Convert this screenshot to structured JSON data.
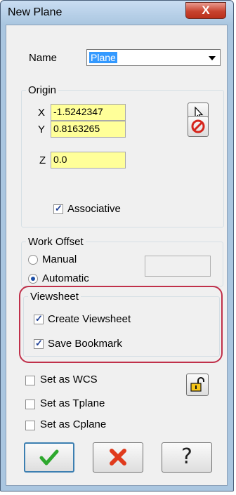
{
  "window": {
    "title": "New Plane",
    "close_label": "X"
  },
  "name": {
    "label": "Name",
    "value": "Plane"
  },
  "origin": {
    "title": "Origin",
    "x_label": "X",
    "x_value": "-1.5242347",
    "y_label": "Y",
    "y_value": "0.8163265",
    "z_label": "Z",
    "z_value": "0.0",
    "associative_label": "Associative",
    "associative_checked": true
  },
  "work_offset": {
    "title": "Work Offset",
    "manual_label": "Manual",
    "automatic_label": "Automatic",
    "selected": "Automatic"
  },
  "viewsheet": {
    "title": "Viewsheet",
    "create_label": "Create Viewsheet",
    "create_checked": true,
    "bookmark_label": "Save Bookmark",
    "bookmark_checked": true
  },
  "set_as": {
    "wcs_label": "Set as WCS",
    "tplane_label": "Set as Tplane",
    "cplane_label": "Set as Cplane"
  },
  "icons": {
    "select_point": "cursor-arrow-icon",
    "clear": "no-entry-icon",
    "lock": "open-padlock-icon",
    "ok": "green-check-icon",
    "cancel": "red-x-icon",
    "help": "question-mark-icon"
  },
  "colors": {
    "title_bar": "#aac6e0",
    "field_highlight": "#ffff99",
    "selection": "#3399ff",
    "annotation_outline": "#c0304a",
    "ok_green": "#2ea82e",
    "cancel_red": "#e03a1c"
  }
}
